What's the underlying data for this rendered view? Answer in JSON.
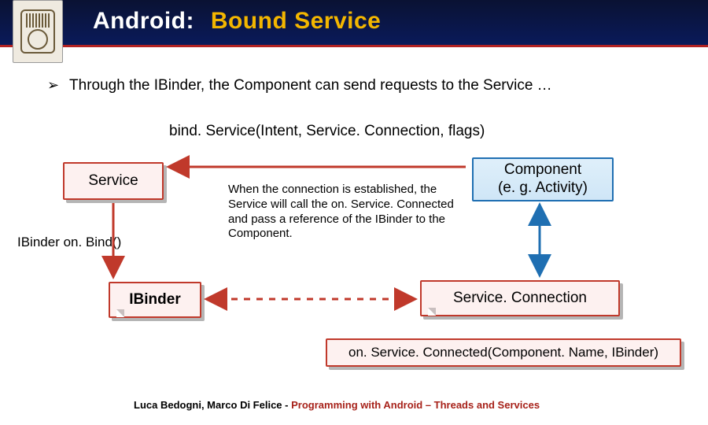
{
  "header": {
    "title_prefix": "Android:",
    "title_suffix": "Bound Service"
  },
  "bullet": {
    "glyph": "➢",
    "text": "Through the IBinder, the Component can send requests to the Service …"
  },
  "call": {
    "text": "bind. Service(Intent, Service. Connection, flags)"
  },
  "boxes": {
    "service": "Service",
    "component_line1": "Component",
    "component_line2": "(e. g. Activity)",
    "ibinder": "IBinder",
    "service_connection": "Service. Connection"
  },
  "onbind": "IBinder on. Bind()",
  "description": "When the connection is established, the Service will call the on. Service. Connected and pass a reference of the IBinder to the Component.",
  "callback": "on. Service. Connected(Component. Name, IBinder)",
  "footer": {
    "authors": "Luca Bedogni, Marco Di Felice",
    "dash": " - ",
    "topic": "Programming with Android – Threads and Services"
  },
  "icons": {
    "seal": "university-seal-icon"
  }
}
